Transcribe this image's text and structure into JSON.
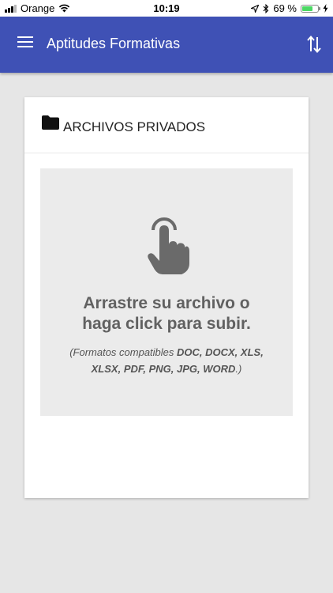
{
  "status_bar": {
    "carrier": "Orange",
    "time": "10:19",
    "battery_percent": "69 %",
    "battery_level": 0.69,
    "signal_bars_filled": 3
  },
  "app_bar": {
    "title": "Aptitudes Formativas",
    "menu_icon": "hamburger-menu-icon",
    "sort_icon": "sort-arrows-icon",
    "color": "#3f51b5"
  },
  "card": {
    "title": "ARCHIVOS PRIVADOS",
    "title_icon": "folder-icon"
  },
  "dropzone": {
    "icon": "touch-hand-icon",
    "heading_line1": "Arrastre su archivo o",
    "heading_line2": "haga click para subir.",
    "formats_prefix": "(Formatos compatibles ",
    "formats_list_line1": "DOC, DOCX, XLS,",
    "formats_list_line2": "XLSX, PDF, PNG, JPG, WORD",
    "formats_suffix": ".)"
  }
}
